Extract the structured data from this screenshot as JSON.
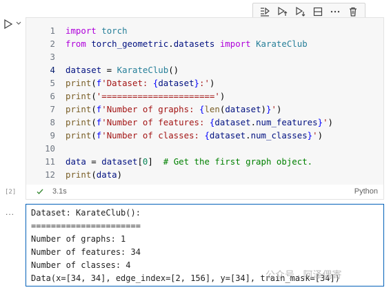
{
  "toolbar": {
    "buttons": [
      "run-by-line-icon",
      "execute-above-icon",
      "execute-below-icon",
      "split-cell-icon",
      "more-icon",
      "delete-icon"
    ]
  },
  "cell": {
    "execution_count": "[2]",
    "duration": "3.1s",
    "language": "Python",
    "lines": [
      {
        "n": "1",
        "tokens": [
          [
            "kw2",
            "import"
          ],
          [
            "plain",
            " "
          ],
          [
            "mod",
            "torch"
          ]
        ]
      },
      {
        "n": "2",
        "tokens": [
          [
            "kw2",
            "from"
          ],
          [
            "plain",
            " "
          ],
          [
            "var",
            "torch_geometric"
          ],
          [
            "plain",
            "."
          ],
          [
            "var",
            "datasets"
          ],
          [
            "plain",
            " "
          ],
          [
            "kw2",
            "import"
          ],
          [
            "plain",
            " "
          ],
          [
            "mod",
            "KarateClub"
          ]
        ]
      },
      {
        "n": "3",
        "tokens": []
      },
      {
        "n": "4",
        "tokens": [
          [
            "var",
            "dataset"
          ],
          [
            "plain",
            " = "
          ],
          [
            "mod",
            "KarateClub"
          ],
          [
            "plain",
            "()"
          ]
        ]
      },
      {
        "n": "5",
        "tokens": [
          [
            "fn",
            "print"
          ],
          [
            "plain",
            "("
          ],
          [
            "kw",
            "f"
          ],
          [
            "str",
            "'Dataset: "
          ],
          [
            "kw",
            "{"
          ],
          [
            "var",
            "dataset"
          ],
          [
            "kw",
            "}"
          ],
          [
            "str",
            ":'"
          ],
          [
            "plain",
            ")"
          ]
        ]
      },
      {
        "n": "6",
        "tokens": [
          [
            "fn",
            "print"
          ],
          [
            "plain",
            "("
          ],
          [
            "str",
            "'======================'"
          ],
          [
            "plain",
            ")"
          ]
        ]
      },
      {
        "n": "7",
        "tokens": [
          [
            "fn",
            "print"
          ],
          [
            "plain",
            "("
          ],
          [
            "kw",
            "f"
          ],
          [
            "str",
            "'Number of graphs: "
          ],
          [
            "kw",
            "{"
          ],
          [
            "fn",
            "len"
          ],
          [
            "plain",
            "("
          ],
          [
            "var",
            "dataset"
          ],
          [
            "plain",
            ")"
          ],
          [
            "kw",
            "}"
          ],
          [
            "str",
            "'"
          ],
          [
            "plain",
            ")"
          ]
        ]
      },
      {
        "n": "8",
        "tokens": [
          [
            "fn",
            "print"
          ],
          [
            "plain",
            "("
          ],
          [
            "kw",
            "f"
          ],
          [
            "str",
            "'Number of features: "
          ],
          [
            "kw",
            "{"
          ],
          [
            "var",
            "dataset"
          ],
          [
            "plain",
            "."
          ],
          [
            "var",
            "num_features"
          ],
          [
            "kw",
            "}"
          ],
          [
            "str",
            "'"
          ],
          [
            "plain",
            ")"
          ]
        ]
      },
      {
        "n": "9",
        "tokens": [
          [
            "fn",
            "print"
          ],
          [
            "plain",
            "("
          ],
          [
            "kw",
            "f"
          ],
          [
            "str",
            "'Number of classes: "
          ],
          [
            "kw",
            "{"
          ],
          [
            "var",
            "dataset"
          ],
          [
            "plain",
            "."
          ],
          [
            "var",
            "num_classes"
          ],
          [
            "kw",
            "}"
          ],
          [
            "str",
            "'"
          ],
          [
            "plain",
            ")"
          ]
        ]
      },
      {
        "n": "10",
        "tokens": []
      },
      {
        "n": "11",
        "tokens": [
          [
            "var",
            "data"
          ],
          [
            "plain",
            " = "
          ],
          [
            "var",
            "dataset"
          ],
          [
            "plain",
            "["
          ],
          [
            "num",
            "0"
          ],
          [
            "plain",
            "]  "
          ],
          [
            "com",
            "# Get the first graph object."
          ]
        ]
      },
      {
        "n": "12",
        "tokens": [
          [
            "fn",
            "print"
          ],
          [
            "plain",
            "("
          ],
          [
            "var",
            "data"
          ],
          [
            "plain",
            ")"
          ]
        ]
      }
    ]
  },
  "output": {
    "more_label": "...",
    "lines": [
      "Dataset: KarateClub():",
      "======================",
      "Number of graphs: 1",
      "Number of features: 34",
      "Number of classes: 4",
      "Data(x=[34, 34], edge_index=[2, 156], y=[34], train_mask=[34])"
    ]
  },
  "watermark": "公众号 · 阿泽偶寄"
}
